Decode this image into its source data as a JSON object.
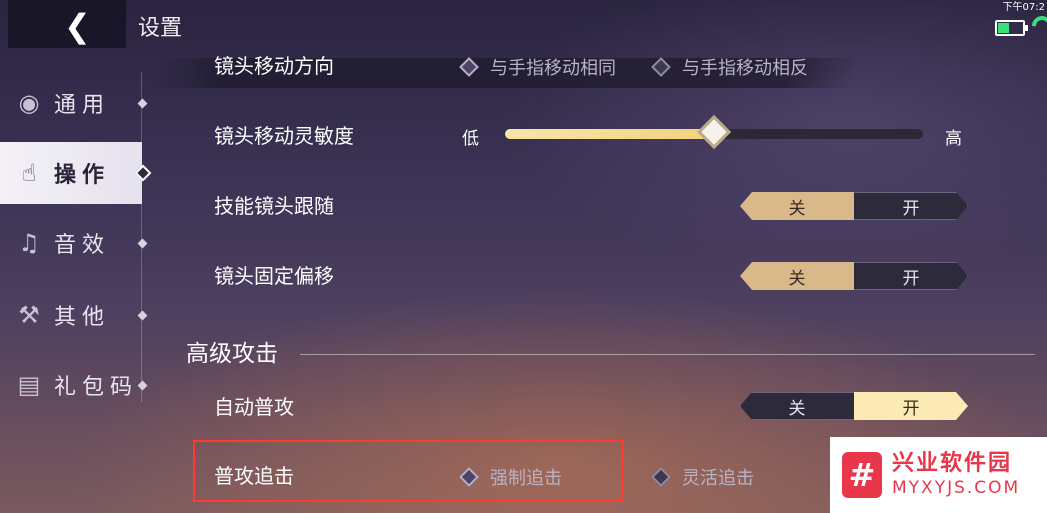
{
  "header": {
    "back_icon": "chevron-left-icon",
    "title": "设置",
    "status_time": "下午07:2"
  },
  "sidebar": {
    "items": [
      {
        "label": "通用",
        "icon": "broadcast-icon",
        "active": false
      },
      {
        "label": "操作",
        "icon": "hand-icon",
        "active": true
      },
      {
        "label": "音效",
        "icon": "headphone-icon",
        "active": false
      },
      {
        "label": "其他",
        "icon": "tools-icon",
        "active": false
      },
      {
        "label": "礼包码",
        "icon": "gift-icon",
        "active": false
      }
    ]
  },
  "settings": {
    "camera_direction": {
      "label": "镜头移动方向",
      "option_same": "与手指移动相同",
      "option_opposite": "与手指移动相反"
    },
    "camera_sensitivity": {
      "label": "镜头移动灵敏度",
      "low": "低",
      "high": "高",
      "value_percent": 50
    },
    "skill_camera_follow": {
      "label": "技能镜头跟随",
      "off": "关",
      "on": "开",
      "state": "off"
    },
    "camera_fixed_offset": {
      "label": "镜头固定偏移",
      "off": "关",
      "on": "开",
      "state": "off"
    },
    "advanced_section_title": "高级攻击",
    "auto_attack": {
      "label": "自动普攻",
      "off": "关",
      "on": "开",
      "state": "on"
    },
    "attack_chase": {
      "label": "普攻追击",
      "option_forced": "强制追击",
      "option_flexible": "灵活追击"
    }
  },
  "watermark": {
    "title": "兴业软件园",
    "url": "MYXYJS.COM",
    "logo_glyph": "#"
  },
  "colors": {
    "accent_gold": "#d9b98a",
    "accent_cream": "#fbeab4",
    "highlight_red": "#ff3b30",
    "battery_green": "#38e07a"
  }
}
